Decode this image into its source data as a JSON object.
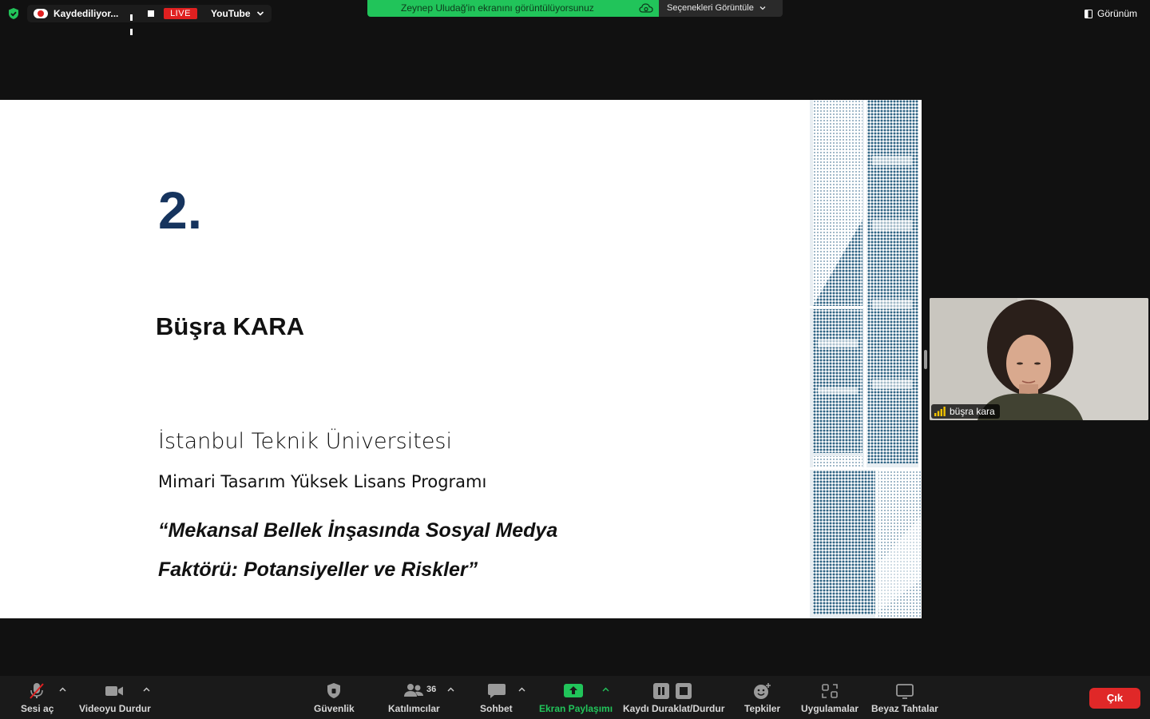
{
  "top_bar": {
    "recording_label": "Kaydediliyor...",
    "live_badge": "LIVE",
    "stream_target": "YouTube",
    "share_banner": "Zeynep Uludağ'in ekranını görüntülüyorsunuz",
    "view_options": "Seçenekleri Görüntüle",
    "view_menu": "Görünüm"
  },
  "slide": {
    "number": "2.",
    "name": "Büşra KARA",
    "university": "İstanbul Teknik Üniversitesi",
    "program": "Mimari Tasarım Yüksek Lisans Programı",
    "title_line1": "“Mekansal Bellek İnşasında Sosyal Medya",
    "title_line2": "Faktörü: Potansiyeller ve Riskler”"
  },
  "participant_video": {
    "name": "büşra kara"
  },
  "toolbar": {
    "unmute": "Sesi aç",
    "stop_video": "Videoyu Durdur",
    "security": "Güvenlik",
    "participants": "Katılımcılar",
    "participant_count": "36",
    "chat": "Sohbet",
    "share_screen": "Ekran Paylaşımı",
    "pause_stop_recording": "Kaydı Duraklat/Durdur",
    "reactions": "Tepkiler",
    "apps": "Uygulamalar",
    "whiteboards": "Beyaz Tahtalar",
    "leave": "Çık"
  },
  "colors": {
    "share_green": "#21c45a",
    "live_red": "#e02020",
    "leave_red": "#e02828",
    "slide_number_navy": "#16345e",
    "art_blue": "#2f6484"
  },
  "icons": [
    "shield-check-icon",
    "record-icon",
    "pause-icon",
    "stop-icon",
    "chevron-down-icon",
    "cloud-icon",
    "view-icon",
    "signal-icon",
    "mic-muted-icon",
    "video-camera-icon",
    "shield-icon",
    "participants-icon",
    "chat-icon",
    "share-screen-icon",
    "pause-record-icon",
    "reactions-icon",
    "apps-icon",
    "whiteboard-icon"
  ]
}
